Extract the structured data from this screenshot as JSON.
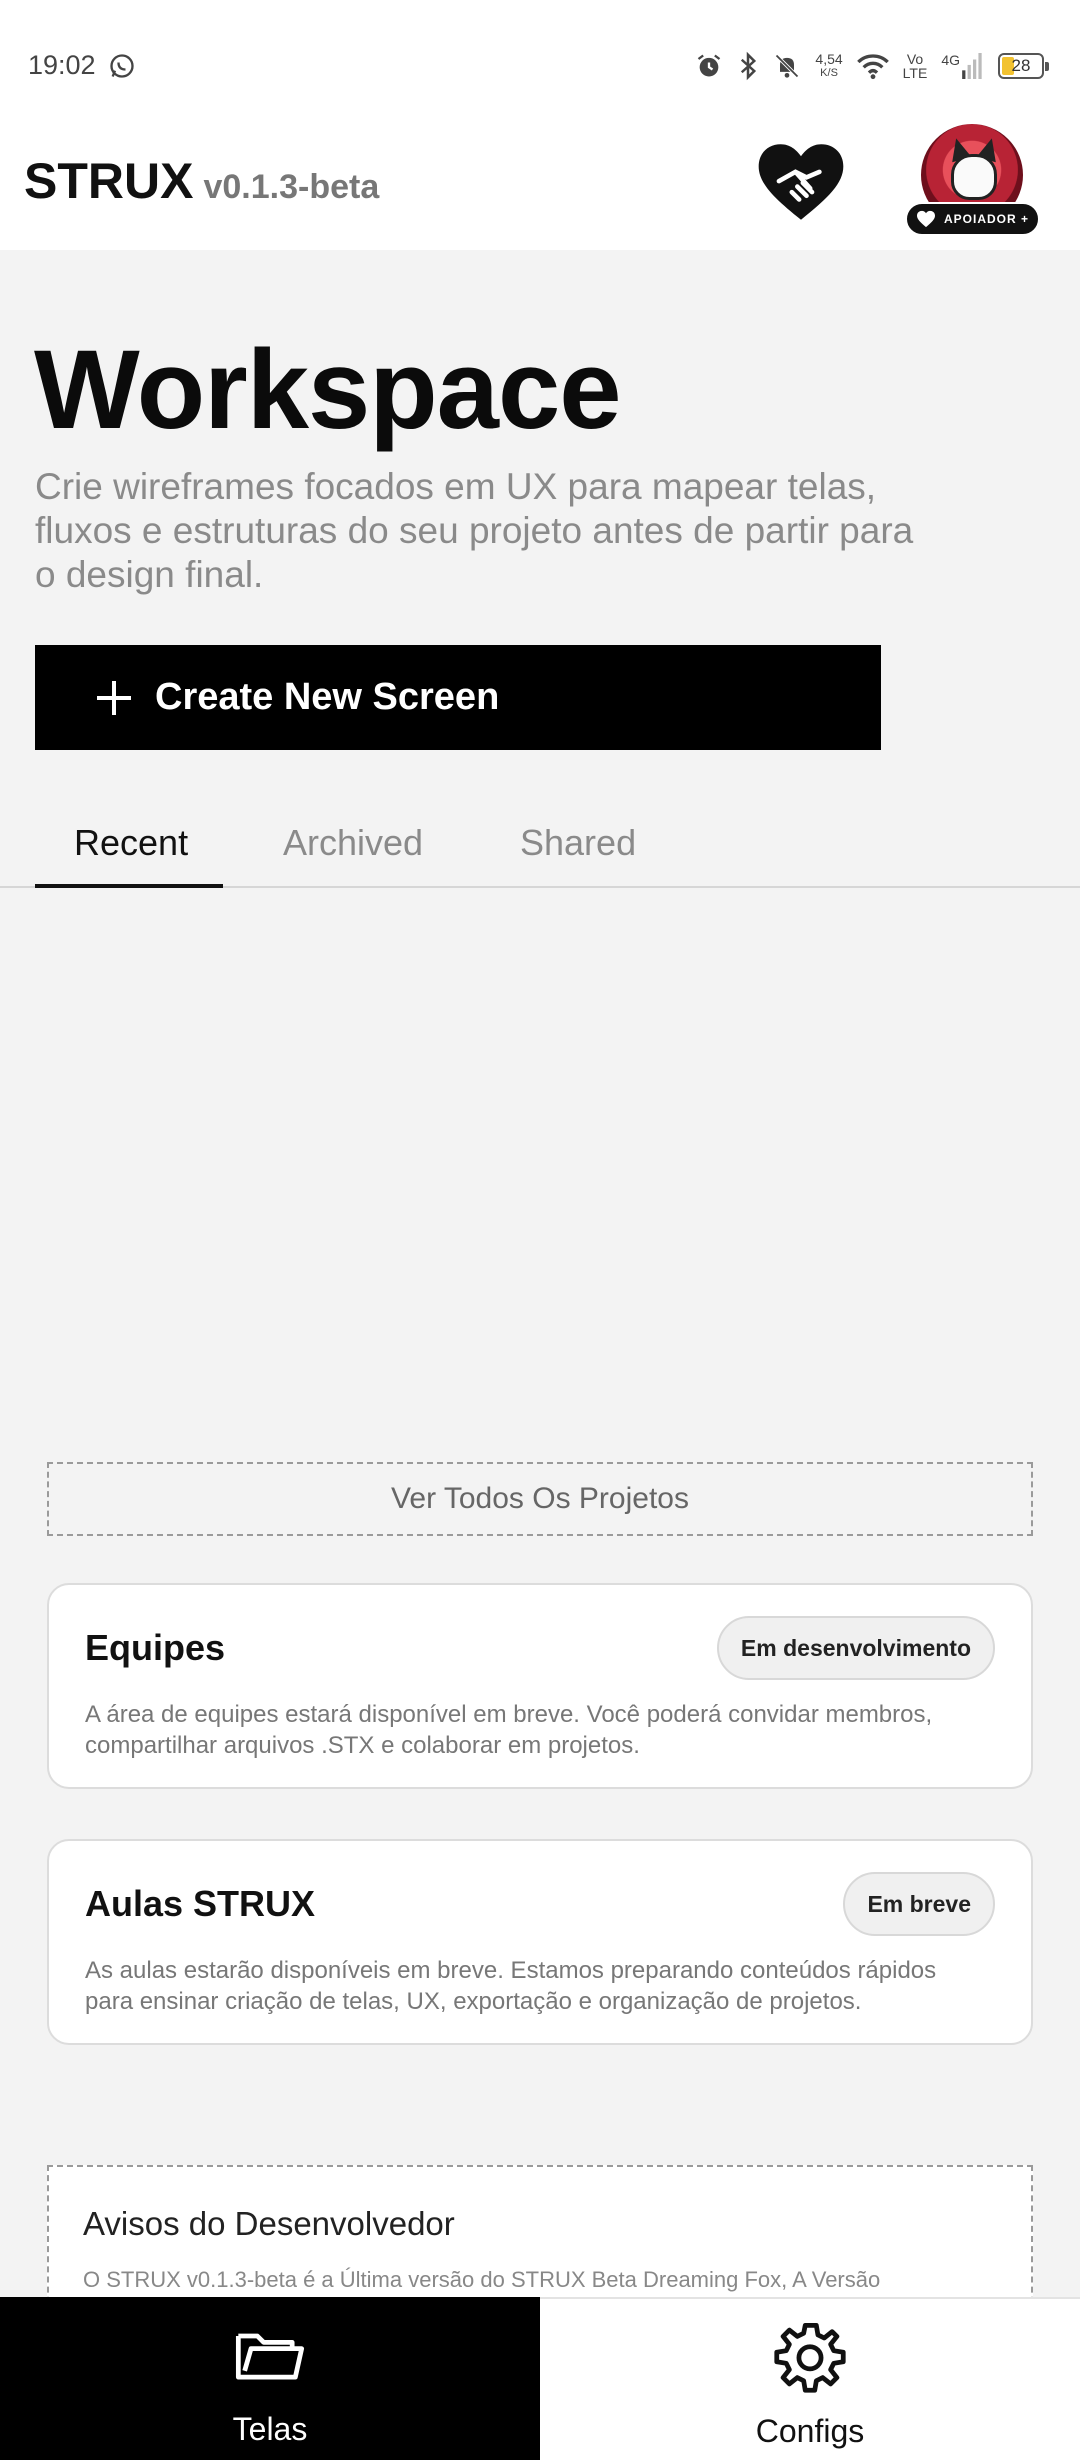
{
  "status_bar": {
    "time": "19:02",
    "speed_value": "4,54",
    "speed_unit": "K/S",
    "volte_top": "Vo",
    "volte_bottom": "LTE",
    "network": "4G",
    "battery_level": "28",
    "icons": [
      "whatsapp-icon",
      "alarm-icon",
      "bluetooth-icon",
      "mute-icon",
      "wifi-icon",
      "signal-icon",
      "battery-icon"
    ]
  },
  "header": {
    "app_name": "STRUX",
    "version": "v0.1.3-beta",
    "supporter_badge": "APOIADOR +",
    "icons": [
      "handshake-heart-icon",
      "avatar"
    ]
  },
  "workspace": {
    "title": "Workspace",
    "subtitle": "Crie wireframes focados em UX para mapear telas, fluxos e estruturas do seu projeto antes de partir para o design final.",
    "create_button": "Create New Screen"
  },
  "tabs": [
    {
      "label": "Recent",
      "active": true
    },
    {
      "label": "Archived",
      "active": false
    },
    {
      "label": "Shared",
      "active": false
    }
  ],
  "see_all": "Ver Todos Os Projetos",
  "cards": [
    {
      "title": "Equipes",
      "badge": "Em desenvolvimento",
      "text": "A área de equipes estará disponível em breve. Você poderá convidar membros, compartilhar arquivos .STX e colaborar em projetos."
    },
    {
      "title": "Aulas STRUX",
      "badge": "Em breve",
      "text": "As aulas estarão disponíveis em breve. Estamos preparando conteúdos rápidos para ensinar criação de telas, UX, exportação e organização de projetos."
    }
  ],
  "notice": {
    "title": "Avisos do Desenvolvedor",
    "text": "O STRUX v0.1.3-beta é a Última versão do STRUX Beta Dreaming Fox, A Versão"
  },
  "bottom_nav": [
    {
      "label": "Telas",
      "icon": "folder-icon",
      "active": true
    },
    {
      "label": "Configs",
      "icon": "gear-icon",
      "active": false
    }
  ],
  "colors": {
    "background": "#f3f3f3",
    "primary": "#000000",
    "muted_text": "#8a8a8a",
    "battery_fill": "#f2c230"
  }
}
